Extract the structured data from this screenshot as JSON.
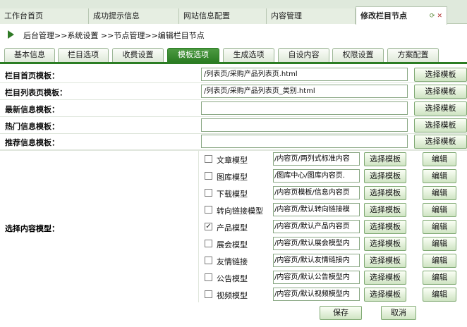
{
  "top_tabs": [
    {
      "label": "工作台首页"
    },
    {
      "label": "成功提示信息"
    },
    {
      "label": "网站信息配置"
    },
    {
      "label": "内容管理"
    },
    {
      "label": "修改栏目节点"
    }
  ],
  "breadcrumb": "后台管理>>系统设置 >>节点管理>>编辑栏目节点",
  "sub_tabs": [
    {
      "label": "基本信息"
    },
    {
      "label": "栏目选项"
    },
    {
      "label": "收费设置"
    },
    {
      "label": "模板选项"
    },
    {
      "label": "生成选项"
    },
    {
      "label": "自设内容"
    },
    {
      "label": "权限设置"
    },
    {
      "label": "方案配置"
    }
  ],
  "template_rows": [
    {
      "label": "栏目首页模板：",
      "value": "/列表页/采购产品列表页.html",
      "button": "选择模板"
    },
    {
      "label": "栏目列表页模板：",
      "value": "/列表页/采购产品列表页_类别.html",
      "button": "选择模板"
    },
    {
      "label": "最新信息模板：",
      "value": "",
      "button": "选择模板"
    },
    {
      "label": "热门信息模板：",
      "value": "",
      "button": "选择模板"
    },
    {
      "label": "推荐信息模板：",
      "value": "",
      "button": "选择模板"
    }
  ],
  "content_models_label": "选择内容模型：",
  "content_models": [
    {
      "name": "文章模型",
      "checked": false,
      "path": "/内容页/两列式标准内容",
      "select": "选择模板",
      "edit": "编辑"
    },
    {
      "name": "图库模型",
      "checked": false,
      "path": "/图库中心/图库内容页.",
      "select": "选择模板",
      "edit": "编辑"
    },
    {
      "name": "下载模型",
      "checked": false,
      "path": "/内容页模板/信息内容页",
      "select": "选择模板",
      "edit": "编辑"
    },
    {
      "name": "转向链接模型",
      "checked": false,
      "path": "/内容页/默认转向链接模",
      "select": "选择模板",
      "edit": "编辑"
    },
    {
      "name": "产品模型",
      "checked": true,
      "path": "/内容页/默认产品内容页",
      "select": "选择模板",
      "edit": "编辑"
    },
    {
      "name": "展会模型",
      "checked": false,
      "path": "/内容页/默认展会模型内",
      "select": "选择模板",
      "edit": "编辑"
    },
    {
      "name": "友情链接",
      "checked": false,
      "path": "/内容页/默认友情链接内",
      "select": "选择模板",
      "edit": "编辑"
    },
    {
      "name": "公告模型",
      "checked": false,
      "path": "/内容页/默认公告模型内",
      "select": "选择模板",
      "edit": "编辑"
    },
    {
      "name": "视频模型",
      "checked": false,
      "path": "/内容页/默认视频模型内",
      "select": "选择模板",
      "edit": "编辑"
    }
  ],
  "save_label": "保存",
  "cancel_label": "取消",
  "colors": {
    "accent_green": "#2b7d23",
    "tab_bg": "#dfe9dc"
  }
}
